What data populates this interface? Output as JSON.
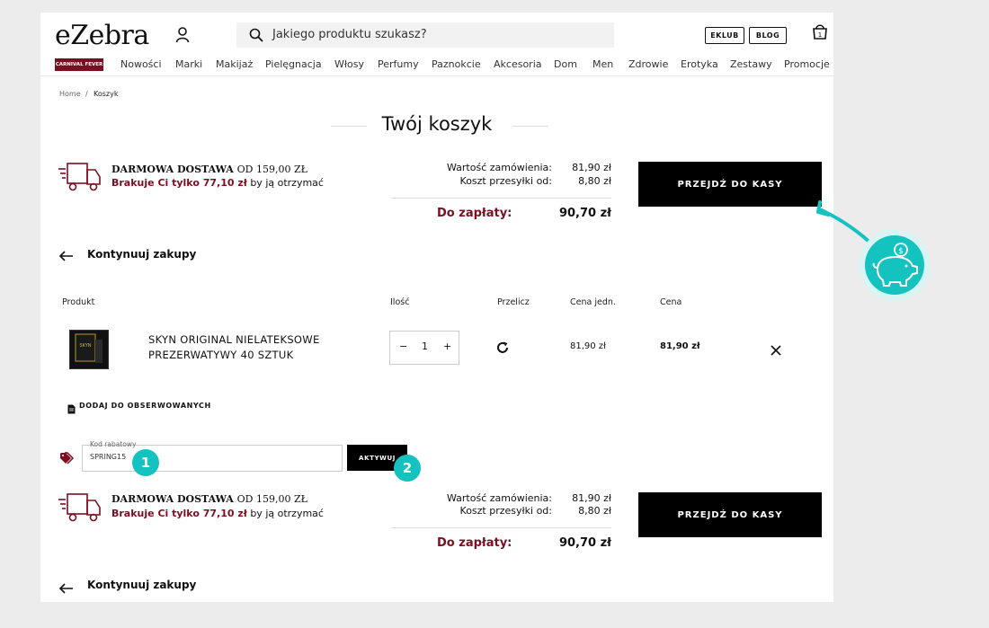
{
  "header": {
    "logo": "eZebra",
    "search_placeholder": "Jakiego produktu szukasz?",
    "pills": [
      "EKLUB",
      "BLOG"
    ],
    "cart_count": "1"
  },
  "nav": {
    "promo_label": "CARNIVAL FEVER",
    "items": [
      "Nowości",
      "Marki",
      "Makijaż",
      "Pielęgnacja",
      "Włosy",
      "Perfumy",
      "Paznokcie",
      "Akcesoria",
      "Dom",
      "Men",
      "Zdrowie",
      "Erotyka",
      "Zestawy",
      "Promocje"
    ]
  },
  "breadcrumb": {
    "home": "Home",
    "separator": "/",
    "current": "Koszyk"
  },
  "page_title": "Twój koszyk",
  "shipping": {
    "free_label": "DARMOWA DOSTAWA",
    "free_from": "OD 159,00 ZŁ",
    "missing_bold": "Brakuje Ci tylko 77,10 zł",
    "missing_rest": " by ją otrzymać"
  },
  "summary": {
    "order_value_label": "Wartość zamówienia:",
    "order_value": "81,90 zł",
    "shipping_label": "Koszt przesyłki od:",
    "shipping_value": "8,80 zł",
    "total_label": "Do zapłaty:",
    "total_value": "90,70 zł"
  },
  "checkout_label": "PRZEJDŹ DO KASY",
  "continue_label": "Kontynuuj zakupy",
  "table": {
    "headers": {
      "product": "Produkt",
      "qty": "Ilość",
      "recalc": "Przelicz",
      "unit_price": "Cena jedn.",
      "price": "Cena"
    },
    "row": {
      "name_line1": "SKYN ORIGINAL NIELATEKSOWE",
      "name_line2": "PREZERWATYWY 40 SZTUK",
      "image_text": "SKYN",
      "qty_minus": "−",
      "qty": "1",
      "qty_plus": "+",
      "unit_price": "81,90 zł",
      "price": "81,90 zł"
    }
  },
  "watchlist_label": "DODAJ DO OBSERWOWANYCH",
  "coupon": {
    "label": "Kod rabatowy",
    "value": "SPRING15",
    "activate_label": "AKTYWUJ"
  },
  "steps": [
    "1",
    "2"
  ],
  "colors": {
    "accent": "#7a0f21",
    "teal": "#14c2c0",
    "button": "#000000"
  }
}
